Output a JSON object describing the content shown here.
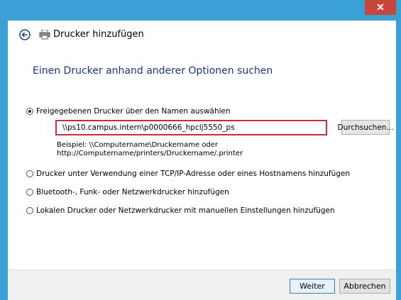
{
  "window": {
    "title": "Drucker hinzufügen",
    "close_glyph": "✕"
  },
  "content": {
    "heading": "Einen Drucker anhand anderer Optionen suchen",
    "options": [
      {
        "label": "Freigegebenen Drucker über den Namen auswählen",
        "selected": true
      },
      {
        "label": "Drucker unter Verwendung einer TCP/IP-Adresse oder eines Hostnamens hinzufügen",
        "selected": false
      },
      {
        "label": "Bluetooth-, Funk- oder Netzwerkdrucker hinzufügen",
        "selected": false
      },
      {
        "label": "Lokalen Drucker oder Netzwerkdrucker mit manuellen Einstellungen hinzufügen",
        "selected": false
      }
    ],
    "printer_path": "\\\\ps10.campus.intern\\p0000666_hpclj5550_ps",
    "browse_label": "Durchsuchen...",
    "example_line1": "Beispiel: \\\\Computername\\Druckername oder",
    "example_line2": "http://Computername/printers/Druckername/.printer"
  },
  "footer": {
    "next_label": "Weiter",
    "cancel_label": "Abbrechen"
  },
  "colors": {
    "frame": "#3aa0d5",
    "close": "#c7463b",
    "heading": "#1e3287",
    "input_border": "#c03238"
  },
  "icons": {
    "back": "back-arrow-icon",
    "printer": "printer-icon",
    "close": "close-icon"
  }
}
